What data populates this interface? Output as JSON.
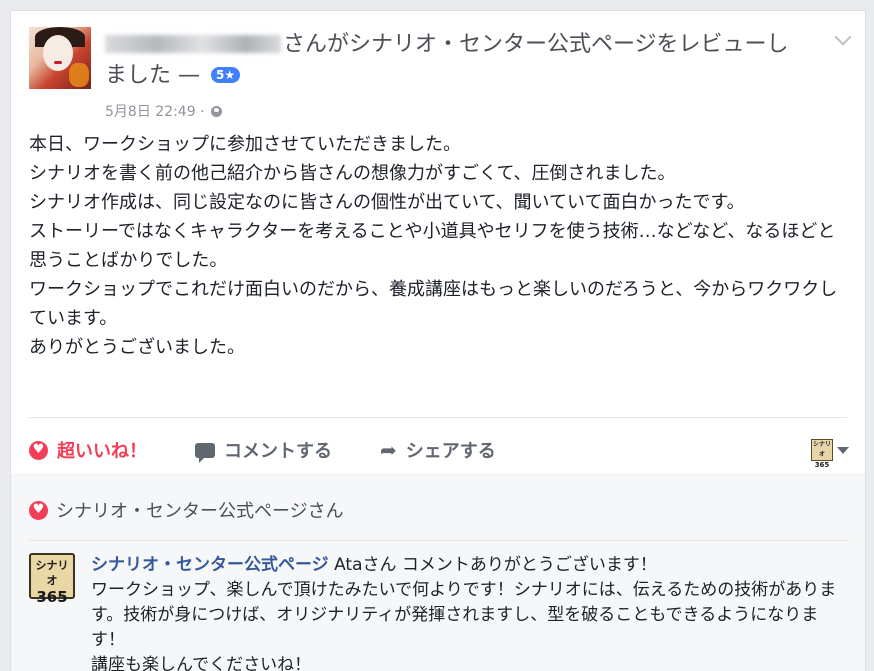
{
  "post": {
    "headline_suffix": "さんがシナリオ・センター公式ページをレビューしました —",
    "rating_badge": "5★",
    "timestamp": "5月8日 22:49 ·",
    "body_lines": [
      "本日、ワークショップに参加させていただきました。",
      "シナリオを書く前の他己紹介から皆さんの想像力がすごくて、圧倒されました。",
      "シナリオ作成は、同じ設定なのに皆さんの個性が出ていて、聞いていて面白かったです。",
      "ストーリーではなくキャラクターを考えることや小道具やセリフを使う技術…などなど、なるほどと思うことばかりでした。",
      "ワークショップでこれだけ面白いのだから、養成講座はもっと楽しいのだろうと、今からワクワクしています。",
      "ありがとうございました。"
    ]
  },
  "actions": {
    "love_label": "超いいね！",
    "comment_label": "コメントする",
    "share_label": "シェアする",
    "page_switch_logo_top": "シナリオ",
    "page_switch_logo_bottom": "365"
  },
  "reactions": {
    "liked_by": "シナリオ・センター公式ページさん"
  },
  "comment": {
    "logo_top": "シナリオ",
    "logo_bottom": "365",
    "author": "シナリオ・センター公式ページ",
    "lines": [
      "Ataさん コメントありがとうございます！",
      "ワークショップ、楽しんで頂けたみたいで何よりです！シナリオには、伝えるための技術があります。技術が身につけば、オリジナリティが発揮されますし、型を破ることもできるようになります！",
      "講座も楽しんでくださいね！"
    ]
  },
  "colors": {
    "love": "#f33e58",
    "link": "#365899",
    "badge": "#4080ff"
  }
}
